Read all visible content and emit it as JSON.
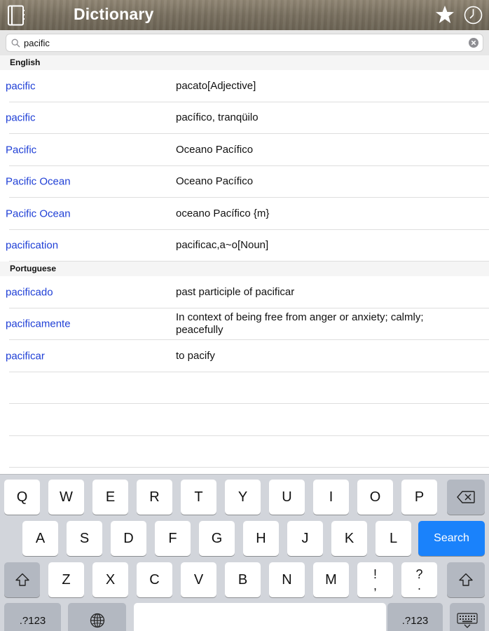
{
  "header": {
    "title": "Dictionary",
    "icons": [
      "book-icon",
      "star-icon",
      "clock-icon"
    ]
  },
  "search": {
    "value": "pacific",
    "icons": [
      "search-icon",
      "clear-icon"
    ]
  },
  "sections": [
    {
      "header": "English",
      "rows": [
        {
          "term": "pacific",
          "translation": "pacato[Adjective]"
        },
        {
          "term": "pacific",
          "translation": "pacífico, tranqüilo"
        },
        {
          "term": "Pacific",
          "translation": "Oceano Pacífico"
        },
        {
          "term": "Pacific Ocean",
          "translation": "Oceano Pacífico"
        },
        {
          "term": "Pacific Ocean",
          "translation": "oceano Pacífico {m}"
        },
        {
          "term": "pacification",
          "translation": "pacificac,a~o[Noun]"
        }
      ]
    },
    {
      "header": "Portuguese",
      "rows": [
        {
          "term": "pacificado",
          "translation": "past participle of pacificar"
        },
        {
          "term": "pacificamente",
          "translation": "In context of being free from anger or anxiety; calmly; peacefully"
        },
        {
          "term": "pacificar",
          "translation": "to pacify"
        }
      ]
    }
  ],
  "keyboard": {
    "row1": [
      "Q",
      "W",
      "E",
      "R",
      "T",
      "Y",
      "U",
      "I",
      "O",
      "P"
    ],
    "row2": [
      "A",
      "S",
      "D",
      "F",
      "G",
      "H",
      "J",
      "K",
      "L"
    ],
    "row3": [
      "Z",
      "X",
      "C",
      "V",
      "B",
      "N",
      "M"
    ],
    "punct1": {
      "top": "!",
      "bottom": ","
    },
    "punct2": {
      "top": "?",
      "bottom": "."
    },
    "search_label": "Search",
    "numbers_label": ".?123",
    "accent": "#1a82fb"
  }
}
